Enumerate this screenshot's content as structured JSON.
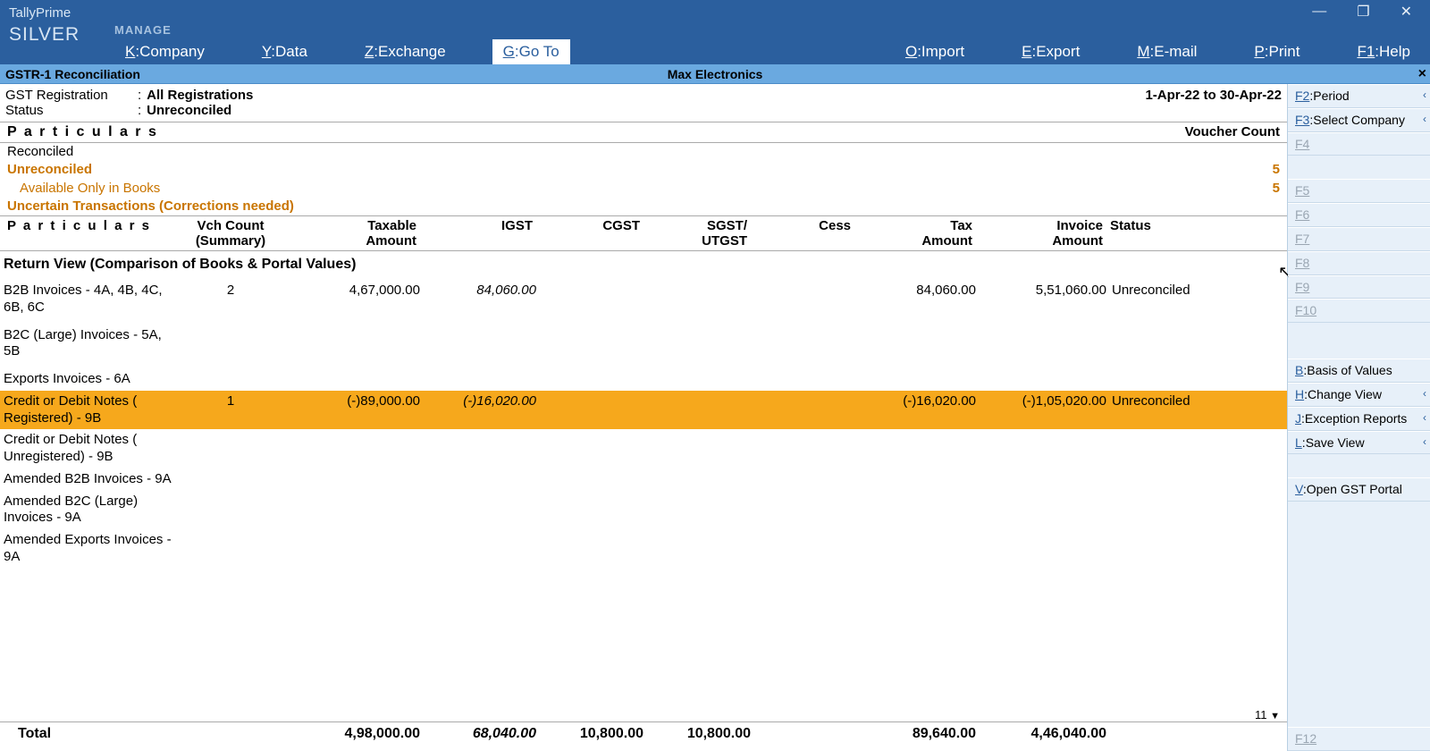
{
  "app": {
    "product": "TallyPrime",
    "edition": "SILVER",
    "manage": "MANAGE"
  },
  "menu": {
    "company": {
      "k": "K",
      "l": "Company"
    },
    "data": {
      "k": "Y",
      "l": "Data"
    },
    "exchange": {
      "k": "Z",
      "l": "Exchange"
    },
    "goto": {
      "k": "G",
      "l": "Go To"
    },
    "import": {
      "k": "O",
      "l": "Import"
    },
    "export": {
      "k": "E",
      "l": "Export"
    },
    "email": {
      "k": "M",
      "l": "E-mail"
    },
    "print": {
      "k": "P",
      "l": "Print"
    },
    "help": {
      "k": "F1",
      "l": "Help"
    }
  },
  "subtitle": {
    "left": "GSTR-1 Reconciliation",
    "center": "Max Electronics",
    "close": "×"
  },
  "header": {
    "gst_label": "GST Registration",
    "gst_value": "All Registrations",
    "status_label": "Status",
    "status_value": "Unreconciled",
    "period": "1-Apr-22 to 30-Apr-22"
  },
  "sect_particulars": "P a r t i c u l a r s",
  "sect_vcount": "Voucher Count",
  "summary": {
    "reconciled": "Reconciled",
    "unreconciled": "Unreconciled",
    "unreconciled_cnt": "5",
    "available": "Available Only in Books",
    "available_cnt": "5",
    "uncertain": "Uncertain Transactions (Corrections needed)"
  },
  "cols": {
    "part": "P a r t i c u l a r s",
    "vch1": "Vch Count",
    "vch2": "(Summary)",
    "tax1": "Taxable",
    "tax2": "Amount",
    "igst": "IGST",
    "cgst": "CGST",
    "sgst1": "SGST/",
    "sgst2": "UTGST",
    "cess": "Cess",
    "taxamt1": "Tax",
    "taxamt2": "Amount",
    "inv1": "Invoice",
    "inv2": "Amount",
    "status": "Status"
  },
  "section_title": "Return View (Comparison of Books & Portal Values)",
  "rows": [
    {
      "part": "B2B Invoices - 4A, 4B, 4C, 6B, 6C",
      "vch": "2",
      "tax": "4,67,000.00",
      "igst": "84,060.00",
      "cgst": "",
      "sgst": "",
      "cess": "",
      "taxamt": "84,060.00",
      "inv": "5,51,060.00",
      "status": "Unreconciled",
      "hl": false
    },
    {
      "part": "B2C (Large) Invoices - 5A, 5B",
      "vch": "",
      "tax": "",
      "igst": "",
      "cgst": "",
      "sgst": "",
      "cess": "",
      "taxamt": "",
      "inv": "",
      "status": "",
      "hl": false
    },
    {
      "part": "Exports Invoices - 6A",
      "vch": "",
      "tax": "",
      "igst": "",
      "cgst": "",
      "sgst": "",
      "cess": "",
      "taxamt": "",
      "inv": "",
      "status": "",
      "hl": false
    },
    {
      "part": "Credit or Debit Notes ( Registered) - 9B",
      "vch": "1",
      "tax": "(-)89,000.00",
      "igst": "(-)16,020.00",
      "cgst": "",
      "sgst": "",
      "cess": "",
      "taxamt": "(-)16,020.00",
      "inv": "(-)1,05,020.00",
      "status": "Unreconciled",
      "hl": true
    },
    {
      "part": "Credit or Debit Notes ( Unregistered) - 9B",
      "vch": "",
      "tax": "",
      "igst": "",
      "cgst": "",
      "sgst": "",
      "cess": "",
      "taxamt": "",
      "inv": "",
      "status": "",
      "hl": false
    },
    {
      "part": "Amended B2B Invoices - 9A",
      "vch": "",
      "tax": "",
      "igst": "",
      "cgst": "",
      "sgst": "",
      "cess": "",
      "taxamt": "",
      "inv": "",
      "status": "",
      "hl": false
    },
    {
      "part": "Amended B2C (Large) Invoices - 9A",
      "vch": "",
      "tax": "",
      "igst": "",
      "cgst": "",
      "sgst": "",
      "cess": "",
      "taxamt": "",
      "inv": "",
      "status": "",
      "hl": false
    },
    {
      "part": "Amended Exports Invoices - 9A",
      "vch": "",
      "tax": "",
      "igst": "",
      "cgst": "",
      "sgst": "",
      "cess": "",
      "taxamt": "",
      "inv": "",
      "status": "",
      "hl": false
    }
  ],
  "pager": {
    "num": "11",
    "tri": "▼"
  },
  "total": {
    "label": "Total",
    "tax": "4,98,000.00",
    "igst": "68,040.00",
    "cgst": "10,800.00",
    "sgst": "10,800.00",
    "cess": "",
    "taxamt": "89,640.00",
    "inv": "4,46,040.00"
  },
  "rpanel": {
    "f2": {
      "k": "F2",
      "l": "Period"
    },
    "f3": {
      "k": "F3",
      "l": "Select Company"
    },
    "f4": "F4",
    "f5": "F5",
    "f6": "F6",
    "f7": "F7",
    "f8": "F8",
    "f9": "F9",
    "f10": "F10",
    "basis": {
      "k": "B",
      "l": "Basis of Values"
    },
    "change": {
      "k": "H",
      "l": "Change View"
    },
    "except": {
      "k": "J",
      "l": "Exception Reports"
    },
    "save": {
      "k": "L",
      "l": "Save View"
    },
    "portal": {
      "k": "V",
      "l": "Open GST Portal"
    },
    "f12": "F12"
  }
}
